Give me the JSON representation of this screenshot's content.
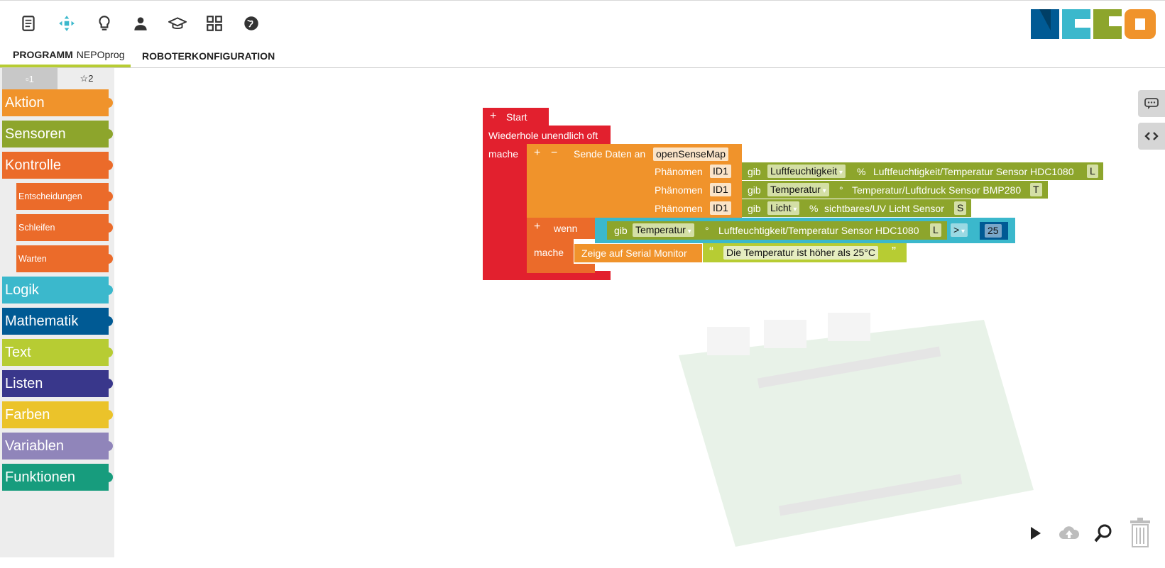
{
  "toolbar": {
    "icons": [
      "document-icon",
      "robot-connect-icon",
      "lightbulb-icon",
      "user-icon",
      "graduation-cap-icon",
      "apps-grid-icon",
      "globe-icon"
    ]
  },
  "tabs": {
    "program_label": "PROGRAMM",
    "program_name": "NEPOprog",
    "robot_config_label": "ROBOTERKONFIGURATION"
  },
  "toolbox": {
    "level_tabs": [
      "▫1",
      "☆2"
    ],
    "categories": [
      {
        "label": "Aktion",
        "color": "#f0932b"
      },
      {
        "label": "Sensoren",
        "color": "#8da52c"
      },
      {
        "label": "Kontrolle",
        "color": "#eb6b2a"
      },
      {
        "label": "Entscheidungen",
        "color": "#eb6b2a"
      },
      {
        "label": "Schleifen",
        "color": "#eb6b2a"
      },
      {
        "label": "Warten",
        "color": "#eb6b2a"
      },
      {
        "label": "Logik",
        "color": "#3bb8cc"
      },
      {
        "label": "Mathematik",
        "color": "#005a94"
      },
      {
        "label": "Text",
        "color": "#b7cc33"
      },
      {
        "label": "Listen",
        "color": "#39378b"
      },
      {
        "label": "Farben",
        "color": "#ebc32a"
      },
      {
        "label": "Variablen",
        "color": "#9085ba"
      },
      {
        "label": "Funktionen",
        "color": "#179c7d"
      }
    ]
  },
  "program": {
    "start": "Start",
    "loop": "Wiederhole unendlich oft",
    "do1": "mache",
    "send": "Sende Daten an",
    "send_target": "openSenseMap",
    "phenomenon_label": "Phänomen",
    "id": "ID1",
    "get": "gib",
    "row1": {
      "measure": "Luftfeuchtigkeit",
      "unit": "%",
      "sensor": "Luftfeuchtigkeit/Temperatur Sensor HDC1080",
      "port": "L"
    },
    "row2": {
      "measure": "Temperatur",
      "unit": "°",
      "sensor": "Temperatur/Luftdruck Sensor BMP280",
      "port": "T"
    },
    "row3": {
      "measure": "Licht",
      "unit": "%",
      "sensor": "sichtbares/UV Licht Sensor",
      "port": "S"
    },
    "if": "wenn",
    "cond": {
      "measure": "Temperatur",
      "unit": "°",
      "sensor": "Luftfeuchtigkeit/Temperatur Sensor HDC1080",
      "port": "L",
      "op": ">",
      "value": "25"
    },
    "do2": "mache",
    "show": "Zeige auf Serial Monitor",
    "text_open": "“",
    "text": "Die Temperatur ist höher als 25°C",
    "text_close": "”"
  },
  "colors": {
    "start_red": "#e2202e",
    "control_orange": "#eb6b2a",
    "action_orange": "#f0932b",
    "sensor_green": "#8da52c",
    "logic_blue": "#3bb8cc",
    "math_blue": "#005a94",
    "text_green": "#b7cc33"
  }
}
